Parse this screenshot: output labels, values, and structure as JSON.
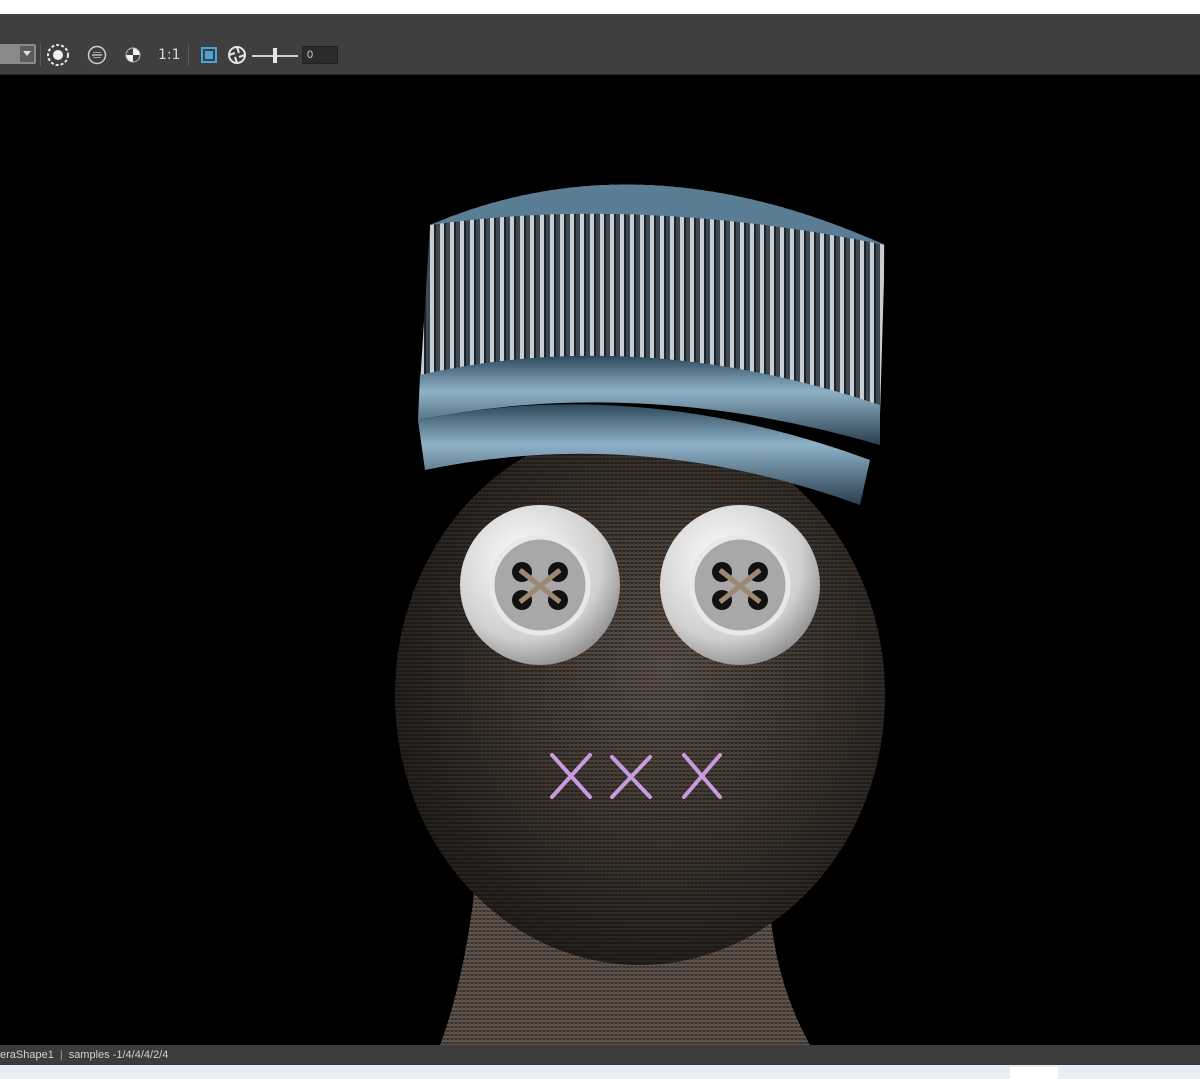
{
  "toolbar": {
    "ratio_label": "1:1",
    "exposure_value": "0",
    "icons": [
      "dropdown-arrow-icon",
      "render-sphere-icon",
      "hdr-icon",
      "color-picker-icon",
      "frame-region-icon",
      "exposure-icon"
    ]
  },
  "status": {
    "camera": "eraShape1",
    "samples": "samples -1/4/4/4/2/4"
  },
  "colors": {
    "toolbar_bg": "#3f3f3f",
    "viewport_bg": "#000000",
    "status_bg": "#3c3c3c",
    "accent_blue": "#4aa3d8"
  }
}
